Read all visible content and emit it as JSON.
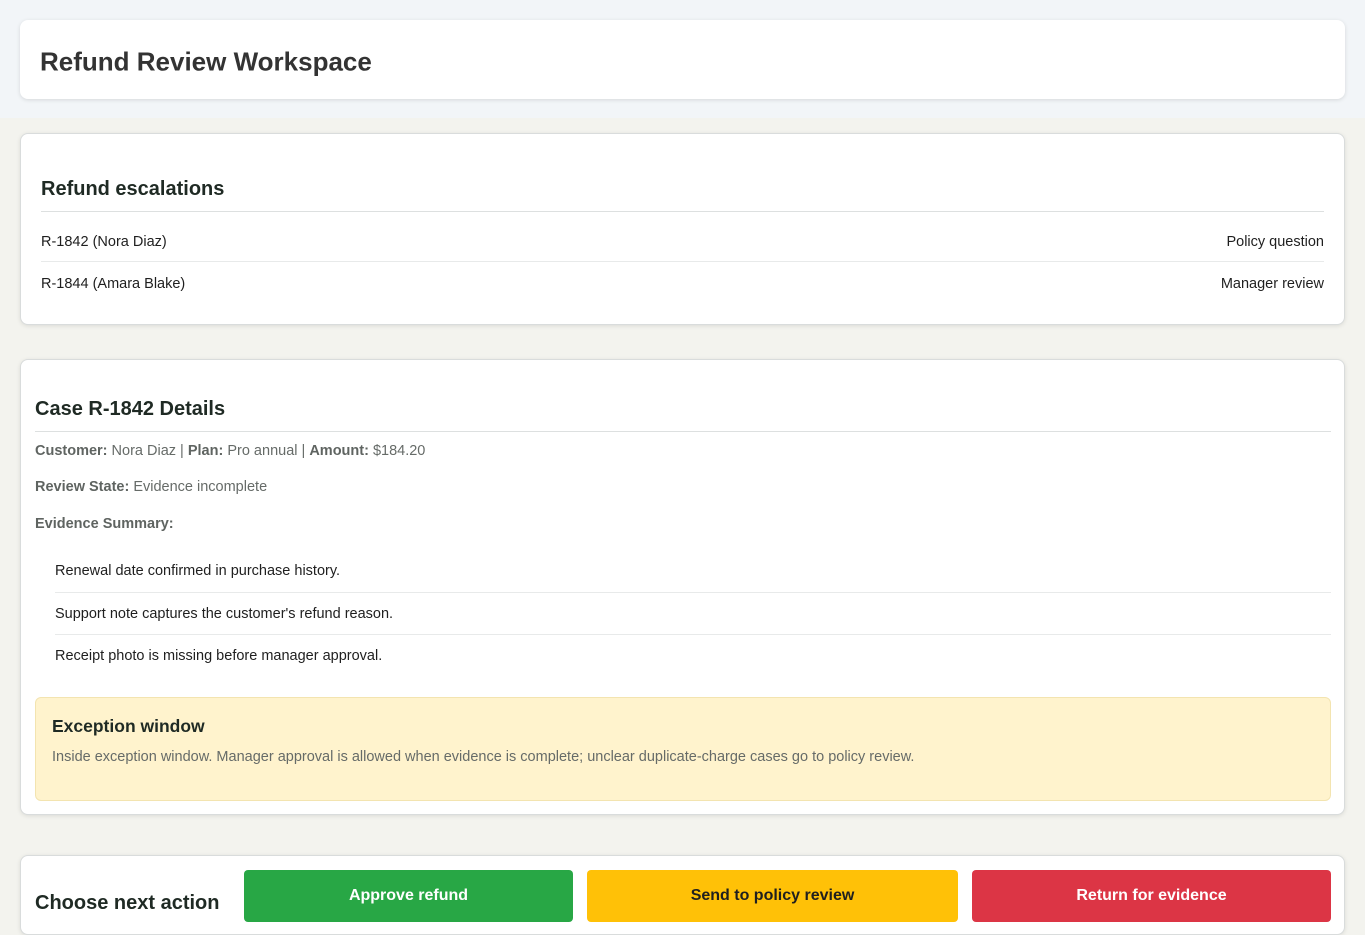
{
  "header": {
    "title": "Refund Review Workspace"
  },
  "escalations": {
    "title": "Refund escalations",
    "items": [
      {
        "case": "R-1842 (Nora Diaz)",
        "status": "Policy question"
      },
      {
        "case": "R-1844 (Amara Blake)",
        "status": "Manager review"
      }
    ]
  },
  "case": {
    "title": "Case R-1842 Details",
    "customer_label": "Customer:",
    "customer": "Nora Diaz",
    "plan_label": "Plan:",
    "plan": "Pro annual",
    "amount_label": "Amount:",
    "amount": "$184.20",
    "separator": "|",
    "review_state_label": "Review State:",
    "review_state": "Evidence incomplete",
    "evidence_label": "Evidence Summary:",
    "evidence": [
      "Renewal date confirmed in purchase history.",
      "Support note captures the customer's refund reason.",
      "Receipt photo is missing before manager approval."
    ],
    "exception": {
      "title": "Exception window",
      "text": "Inside exception window. Manager approval is allowed when evidence is complete; unclear duplicate-charge cases go to policy review."
    }
  },
  "actions": {
    "label": "Choose next action",
    "approve_label": "Approve refund",
    "policy_label": "Send to policy review",
    "request_label": "Return for evidence"
  },
  "colors": {
    "approve": "#28a745",
    "policy": "#ffc107",
    "request": "#dc3545",
    "exception_bg": "#fff3cd"
  }
}
